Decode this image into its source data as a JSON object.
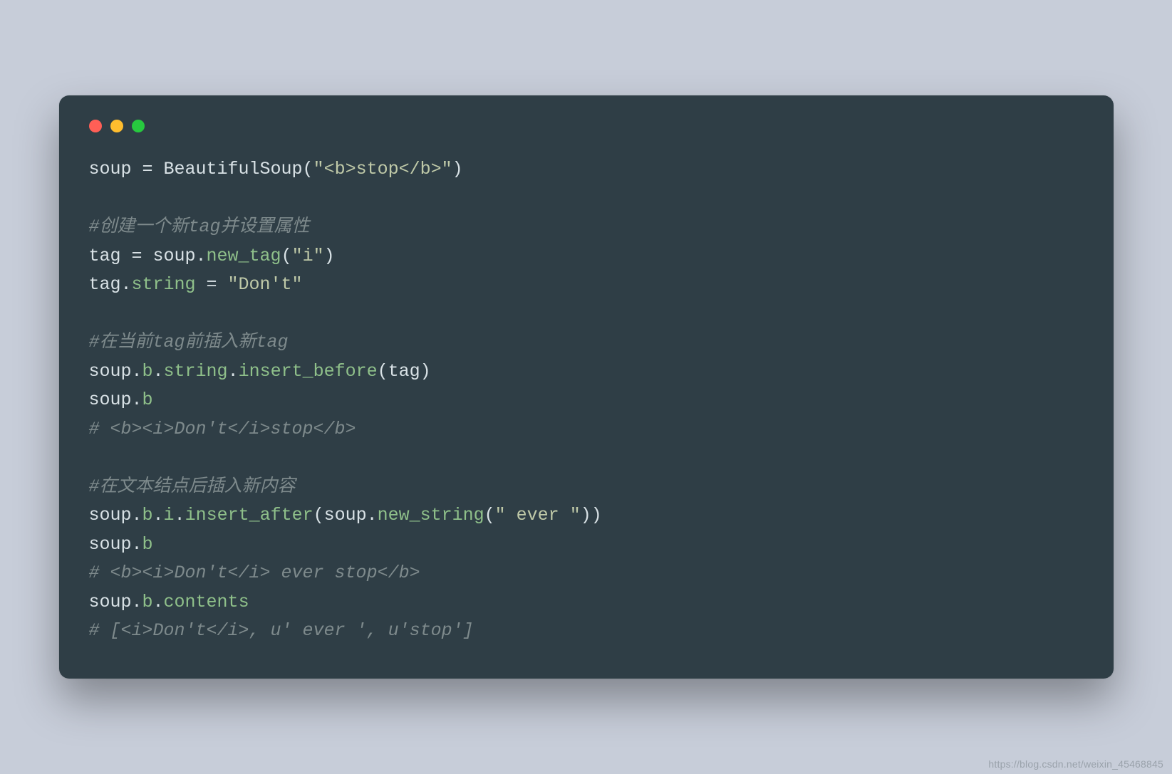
{
  "watermark": "https://blog.csdn.net/weixin_45468845",
  "code_lines": [
    [
      {
        "cls": "tok-ident",
        "text": "soup = BeautifulSoup("
      },
      {
        "cls": "tok-string",
        "text": "\"<b>stop</b>\""
      },
      {
        "cls": "tok-ident",
        "text": ")"
      }
    ],
    [],
    [
      {
        "cls": "tok-comment",
        "text": "#创建一个新tag并设置属性"
      }
    ],
    [
      {
        "cls": "tok-ident",
        "text": "tag = soup."
      },
      {
        "cls": "tok-func",
        "text": "new_tag"
      },
      {
        "cls": "tok-ident",
        "text": "("
      },
      {
        "cls": "tok-string",
        "text": "\"i\""
      },
      {
        "cls": "tok-ident",
        "text": ")"
      }
    ],
    [
      {
        "cls": "tok-ident",
        "text": "tag."
      },
      {
        "cls": "tok-func",
        "text": "string"
      },
      {
        "cls": "tok-ident",
        "text": " = "
      },
      {
        "cls": "tok-string",
        "text": "\"Don't\""
      }
    ],
    [],
    [
      {
        "cls": "tok-comment",
        "text": "#在当前tag前插入新tag"
      }
    ],
    [
      {
        "cls": "tok-ident",
        "text": "soup."
      },
      {
        "cls": "tok-func",
        "text": "b"
      },
      {
        "cls": "tok-ident",
        "text": "."
      },
      {
        "cls": "tok-func",
        "text": "string"
      },
      {
        "cls": "tok-ident",
        "text": "."
      },
      {
        "cls": "tok-func",
        "text": "insert_before"
      },
      {
        "cls": "tok-ident",
        "text": "(tag)"
      }
    ],
    [
      {
        "cls": "tok-ident",
        "text": "soup."
      },
      {
        "cls": "tok-func",
        "text": "b"
      }
    ],
    [
      {
        "cls": "tok-comment",
        "text": "# <b><i>Don't</i>stop</b>"
      }
    ],
    [],
    [
      {
        "cls": "tok-comment",
        "text": "#在文本结点后插入新内容"
      }
    ],
    [
      {
        "cls": "tok-ident",
        "text": "soup."
      },
      {
        "cls": "tok-func",
        "text": "b"
      },
      {
        "cls": "tok-ident",
        "text": "."
      },
      {
        "cls": "tok-func",
        "text": "i"
      },
      {
        "cls": "tok-ident",
        "text": "."
      },
      {
        "cls": "tok-func",
        "text": "insert_after"
      },
      {
        "cls": "tok-ident",
        "text": "(soup."
      },
      {
        "cls": "tok-func",
        "text": "new_string"
      },
      {
        "cls": "tok-ident",
        "text": "("
      },
      {
        "cls": "tok-string",
        "text": "\" ever \""
      },
      {
        "cls": "tok-ident",
        "text": "))"
      }
    ],
    [
      {
        "cls": "tok-ident",
        "text": "soup."
      },
      {
        "cls": "tok-func",
        "text": "b"
      }
    ],
    [
      {
        "cls": "tok-comment",
        "text": "# <b><i>Don't</i> ever stop</b>"
      }
    ],
    [
      {
        "cls": "tok-ident",
        "text": "soup."
      },
      {
        "cls": "tok-func",
        "text": "b"
      },
      {
        "cls": "tok-ident",
        "text": "."
      },
      {
        "cls": "tok-func",
        "text": "contents"
      }
    ],
    [
      {
        "cls": "tok-comment",
        "text": "# [<i>Don't</i>, u' ever ', u'stop']"
      }
    ]
  ]
}
